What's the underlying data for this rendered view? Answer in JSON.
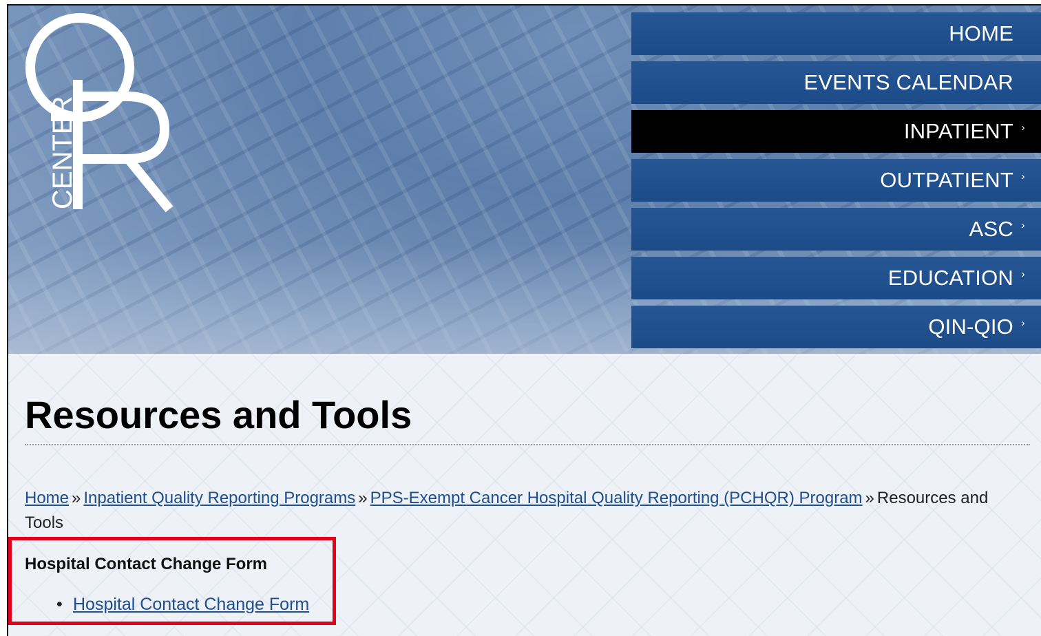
{
  "logo": {
    "text": "CENTER",
    "letters": "QR"
  },
  "nav": {
    "items": [
      {
        "label": "HOME",
        "has_submenu": false,
        "active": false
      },
      {
        "label": "EVENTS CALENDAR",
        "has_submenu": false,
        "active": false
      },
      {
        "label": "INPATIENT",
        "has_submenu": true,
        "active": true
      },
      {
        "label": "OUTPATIENT",
        "has_submenu": true,
        "active": false
      },
      {
        "label": "ASC",
        "has_submenu": true,
        "active": false
      },
      {
        "label": "EDUCATION",
        "has_submenu": true,
        "active": false
      },
      {
        "label": "QIN-QIO",
        "has_submenu": true,
        "active": false
      }
    ],
    "submenu_glyph": "›"
  },
  "page": {
    "title": "Resources and Tools",
    "breadcrumb": {
      "separator": "»",
      "links": [
        "Home",
        "Inpatient Quality Reporting Programs",
        "PPS-Exempt Cancer Hospital Quality Reporting (PCHQR) Program"
      ],
      "current": "Resources and Tools"
    },
    "section": {
      "heading": "Hospital Contact Change Form",
      "bullet": "•",
      "link": "Hospital Contact Change Form"
    }
  },
  "colors": {
    "nav_bg": "#1d4f8f",
    "nav_active_bg": "#000000",
    "link": "#1d4f8f",
    "highlight_border": "#e3001b"
  }
}
